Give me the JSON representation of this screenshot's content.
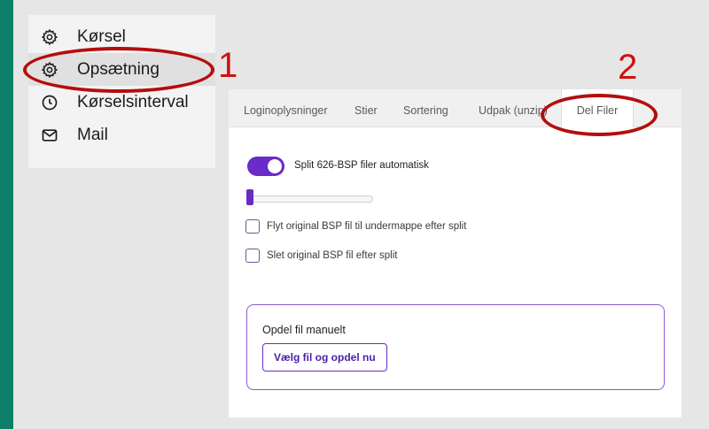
{
  "nav": {
    "items": [
      {
        "label": "Kørsel",
        "icon": "gear-icon"
      },
      {
        "label": "Opsætning",
        "icon": "gear-icon",
        "active": true
      },
      {
        "label": "Kørselsinterval",
        "icon": "clock-icon"
      },
      {
        "label": "Mail",
        "icon": "mail-icon"
      }
    ]
  },
  "tabs": [
    {
      "label": "Loginoplysninger"
    },
    {
      "label": "Stier"
    },
    {
      "label": "Sortering"
    },
    {
      "label": "Udpak (unzip)"
    },
    {
      "label": "Del Filer",
      "active": true
    }
  ],
  "settings": {
    "toggle_label": "Split 626-BSP filer automatisk",
    "toggle_on": true,
    "slider_value": 0,
    "checkbox_move_label": "Flyt original BSP fil til undermappe efter split",
    "checkbox_move_checked": false,
    "checkbox_delete_label": "Slet original BSP fil efter split",
    "checkbox_delete_checked": false
  },
  "manual": {
    "title": "Opdel fil manuelt",
    "button_label": "Vælg fil og opdel nu"
  },
  "annotations": {
    "marker_1": "1",
    "marker_2": "2"
  },
  "colors": {
    "accent": "#6a2bc9",
    "annotation": "#c00000",
    "background": "#0e7f69"
  }
}
